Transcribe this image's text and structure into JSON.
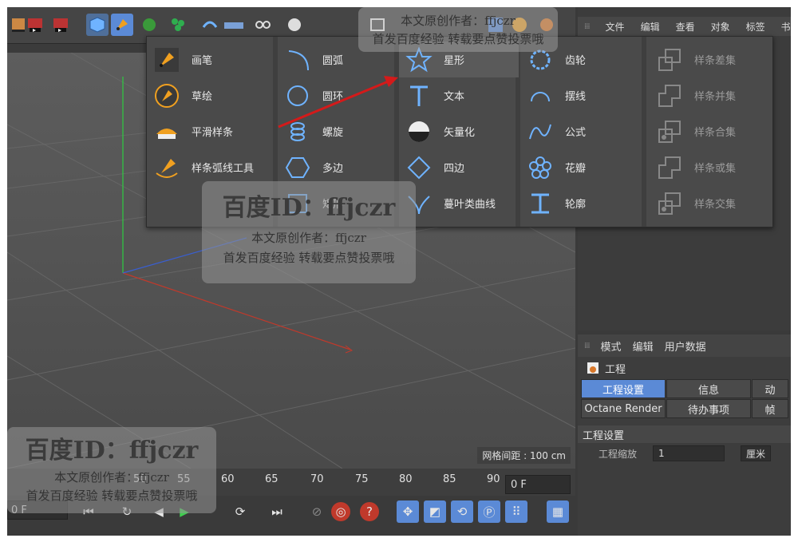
{
  "object_menubar": [
    "文件",
    "编辑",
    "查看",
    "对象",
    "标签",
    "书"
  ],
  "spline_menu": {
    "col1": [
      {
        "label": "画笔",
        "icon": "pen-icon"
      },
      {
        "label": "草绘",
        "icon": "sketch-icon"
      },
      {
        "label": "平滑样条",
        "icon": "smooth-spline-icon"
      },
      {
        "label": "样条弧线工具",
        "icon": "spline-arc-tool-icon"
      }
    ],
    "col2": [
      {
        "label": "圆弧",
        "icon": "arc-icon"
      },
      {
        "label": "圆环",
        "icon": "circle-icon"
      },
      {
        "label": "螺旋",
        "icon": "helix-icon"
      },
      {
        "label": "多边",
        "icon": "polygon-icon"
      },
      {
        "label": "矩形",
        "icon": "rectangle-icon"
      }
    ],
    "col3": [
      {
        "label": "星形",
        "icon": "star-icon"
      },
      {
        "label": "文本",
        "icon": "text-icon"
      },
      {
        "label": "矢量化",
        "icon": "vectorizer-icon"
      },
      {
        "label": "四边",
        "icon": "four-side-icon"
      },
      {
        "label": "蔓叶类曲线",
        "icon": "cissoid-icon"
      }
    ],
    "col4": [
      {
        "label": "齿轮",
        "icon": "cogwheel-icon"
      },
      {
        "label": "摆线",
        "icon": "cycloid-icon"
      },
      {
        "label": "公式",
        "icon": "formula-icon"
      },
      {
        "label": "花瓣",
        "icon": "flower-icon"
      },
      {
        "label": "轮廓",
        "icon": "profile-icon"
      }
    ],
    "col5": [
      {
        "label": "样条差集",
        "icon": "spline-subtract-icon"
      },
      {
        "label": "样条并集",
        "icon": "spline-union-icon"
      },
      {
        "label": "样条合集",
        "icon": "spline-and-icon"
      },
      {
        "label": "样条或集",
        "icon": "spline-or-icon"
      },
      {
        "label": "样条交集",
        "icon": "spline-intersect-icon"
      }
    ]
  },
  "viewport": {
    "grid_spacing": "网格间距 : 100 cm"
  },
  "attributes": {
    "menubar": [
      "模式",
      "编辑",
      "用户数据"
    ],
    "title": "工程",
    "tabs_row1": [
      "工程设置",
      "信息",
      "动"
    ],
    "tabs_row2": [
      "Octane Render",
      "待办事项",
      "帧"
    ],
    "section": "工程设置",
    "row_label": "工程缩放",
    "row_value": "1",
    "row_unit": "厘米"
  },
  "timeline": {
    "ticks": [
      "50",
      "55",
      "60",
      "65",
      "70",
      "75",
      "80",
      "85",
      "90"
    ],
    "current_frame": "0 F",
    "start_frame": "0 F"
  },
  "watermarks": {
    "big": "百度ID：ffjczr",
    "line1": "本文原创作者：ffjczr",
    "line2": "首发百度经验 转载要点赞投票哦"
  },
  "colors": {
    "accent_blue": "#5b8ad6",
    "icon_blue": "#6fb3ff",
    "red_arrow": "#d41a1a"
  }
}
